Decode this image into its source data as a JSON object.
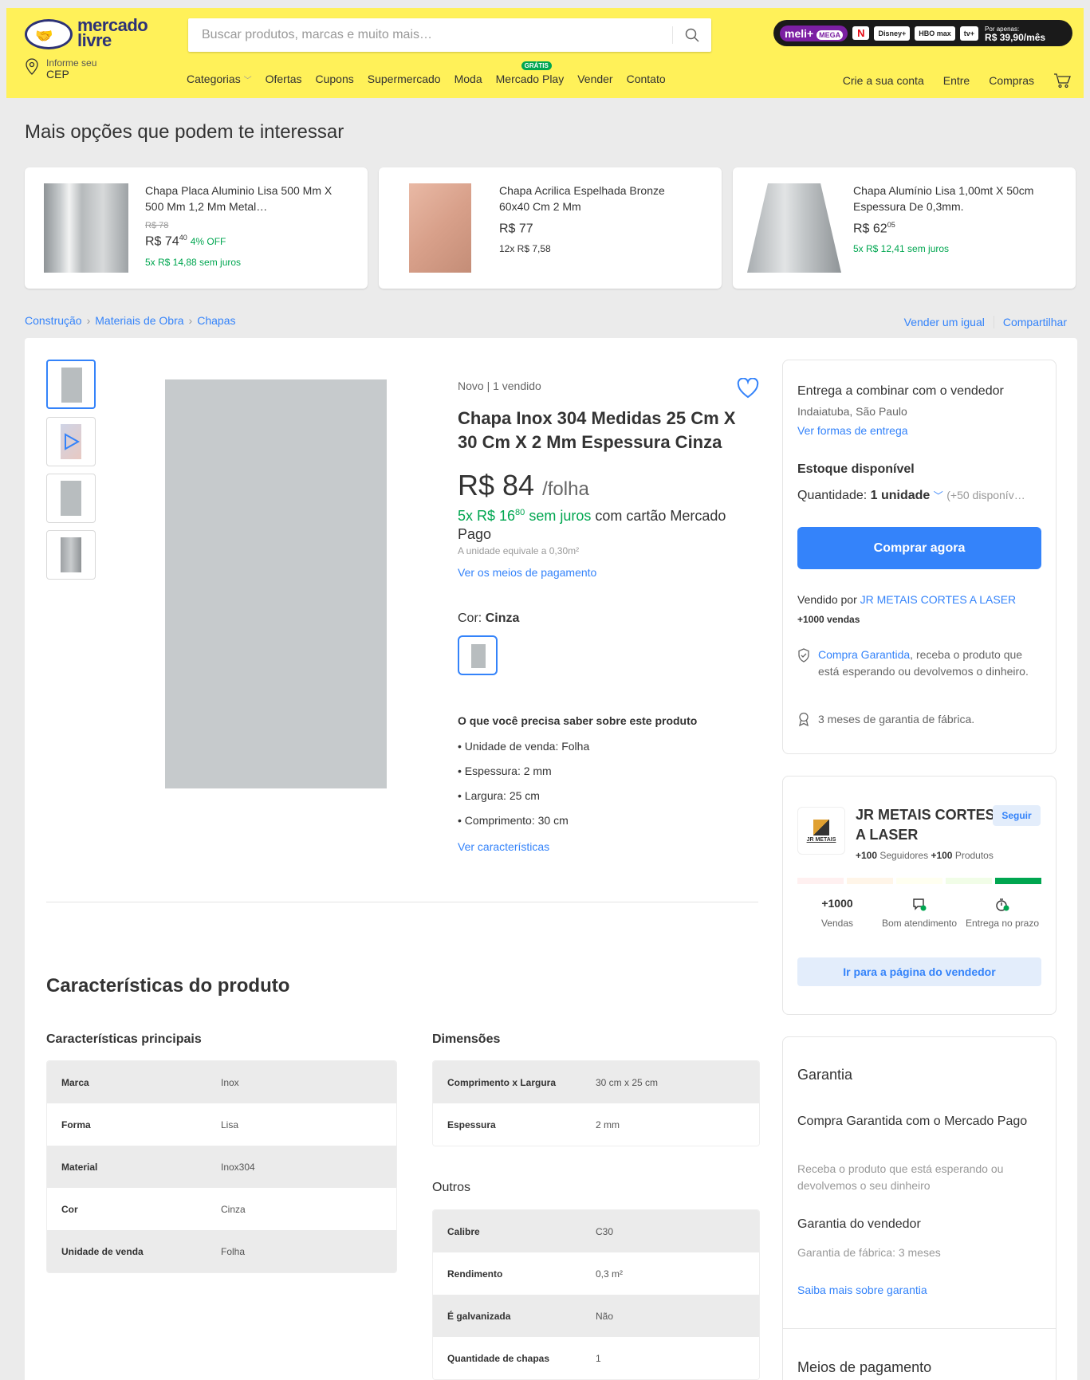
{
  "header": {
    "logo_line1": "mercado",
    "logo_line2": "livre",
    "search_placeholder": "Buscar produtos, marcas e muito mais…",
    "promo": {
      "meli": "meli+",
      "mega": "MEGA",
      "chips": [
        "N",
        "Disney+",
        "HBO max",
        "tv+"
      ],
      "price_small": "Por apenas:",
      "price": "R$ 39,90/mês"
    },
    "cep_line1": "Informe seu",
    "cep_line2": "CEP",
    "nav": [
      "Categorias",
      "Ofertas",
      "Cupons",
      "Supermercado",
      "Moda",
      "Mercado Play",
      "Vender",
      "Contato"
    ],
    "nav_badge": "GRÁTIS",
    "right_links": [
      "Crie a sua conta",
      "Entre",
      "Compras"
    ]
  },
  "recommendations": {
    "title": "Mais opções que podem te interessar",
    "items": [
      {
        "title": "Chapa Placa Aluminio Lisa 500 Mm X 500 Mm 1,2 Mm Metal…",
        "old_price": "R$ 78",
        "price": "R$ 74",
        "cents": "40",
        "off": "4% OFF",
        "installments": "5x R$ 14,88 sem juros"
      },
      {
        "title": "Chapa Acrilica Espelhada Bronze 60x40 Cm 2 Mm",
        "old_price": "",
        "price": "R$ 77",
        "cents": "",
        "off": "",
        "installments": "12x R$ 7,58"
      },
      {
        "title": "Chapa Alumínio Lisa 1,00mt X 50cm Espessura De 0,3mm.",
        "old_price": "",
        "price": "R$ 62",
        "cents": "05",
        "off": "",
        "installments": "5x R$ 12,41 sem juros"
      }
    ]
  },
  "breadcrumb": [
    "Construção",
    "Materiais de Obra",
    "Chapas"
  ],
  "top_links": [
    "Vender um igual",
    "Compartilhar"
  ],
  "product": {
    "condition": "Novo  |  1 vendido",
    "title": "Chapa Inox 304 Medidas 25 Cm X 30 Cm X 2 Mm Espessura Cinza",
    "price": "R$ 84",
    "price_unit": "/folha",
    "installments_green": "5x R$ 16",
    "installments_cents": "80",
    "installments_green2": "sem juros",
    "installments_rest": "com cartão Mercado Pago",
    "unit_equiv": "A unidade equivale a 0,30m²",
    "payment_link": "Ver os meios de pagamento",
    "color_label": "Cor:",
    "color_value": "Cinza",
    "know_title": "O que você precisa saber sobre este produto",
    "bullets": [
      "Unidade de venda: Folha",
      "Espessura: 2 mm",
      "Largura: 25 cm",
      "Comprimento: 30 cm"
    ],
    "see_features": "Ver características"
  },
  "features": {
    "title": "Características do produto",
    "main_title": "Características principais",
    "main": [
      [
        "Marca",
        "Inox"
      ],
      [
        "Forma",
        "Lisa"
      ],
      [
        "Material",
        "Inox304"
      ],
      [
        "Cor",
        "Cinza"
      ],
      [
        "Unidade de venda",
        "Folha"
      ]
    ],
    "dims_title": "Dimensões",
    "dims": [
      [
        "Comprimento x Largura",
        "30 cm x 25 cm"
      ],
      [
        "Espessura",
        "2 mm"
      ]
    ],
    "others_title": "Outros",
    "others": [
      [
        "Calibre",
        "C30"
      ],
      [
        "Rendimento",
        "0,3 m²"
      ],
      [
        "É galvanizada",
        "Não"
      ],
      [
        "Quantidade de chapas",
        "1"
      ]
    ]
  },
  "buy_box": {
    "shipping": "Entrega a combinar com o vendedor",
    "location": "Indaiatuba, São Paulo",
    "shipping_link": "Ver formas de entrega",
    "stock": "Estoque disponível",
    "qty_label": "Quantidade:",
    "qty_value": "1 unidade",
    "qty_available": "(+50 disponív…",
    "buy_button": "Comprar agora",
    "sold_by": "Vendido por",
    "seller_link": "JR METAIS CORTES A LASER",
    "sales": "+1000 vendas",
    "guarantee_link": "Compra Garantida",
    "guarantee_text": ", receba o produto que está esperando ou devolvemos o dinheiro.",
    "factory": "3 meses de garantia de fábrica."
  },
  "seller": {
    "logo_text": "JR METAIS",
    "name": "JR METAIS CORTES A LASER",
    "follow": "Seguir",
    "followers_count": "+100",
    "followers_label": "Seguidores",
    "products_count": "+100",
    "products_label": "Produtos",
    "thermo_colors": [
      "#fff0f0",
      "#fff5e8",
      "#fffff0",
      "#f1fde7",
      "#00a650"
    ],
    "metrics": [
      {
        "top": "+1000",
        "label": "Vendas"
      },
      {
        "top": "",
        "label": "Bom atendimento"
      },
      {
        "top": "",
        "label": "Entrega no prazo"
      }
    ],
    "button": "Ir para a página do vendedor"
  },
  "warranty": {
    "title": "Garantia",
    "mp_title": "Compra Garantida com o Mercado Pago",
    "mp_text": "Receba o produto que está esperando ou devolvemos o seu dinheiro",
    "seller_title": "Garantia do vendedor",
    "seller_text": "Garantia de fábrica: 3 meses",
    "link": "Saiba mais sobre garantia",
    "payments_title": "Meios de pagamento"
  }
}
